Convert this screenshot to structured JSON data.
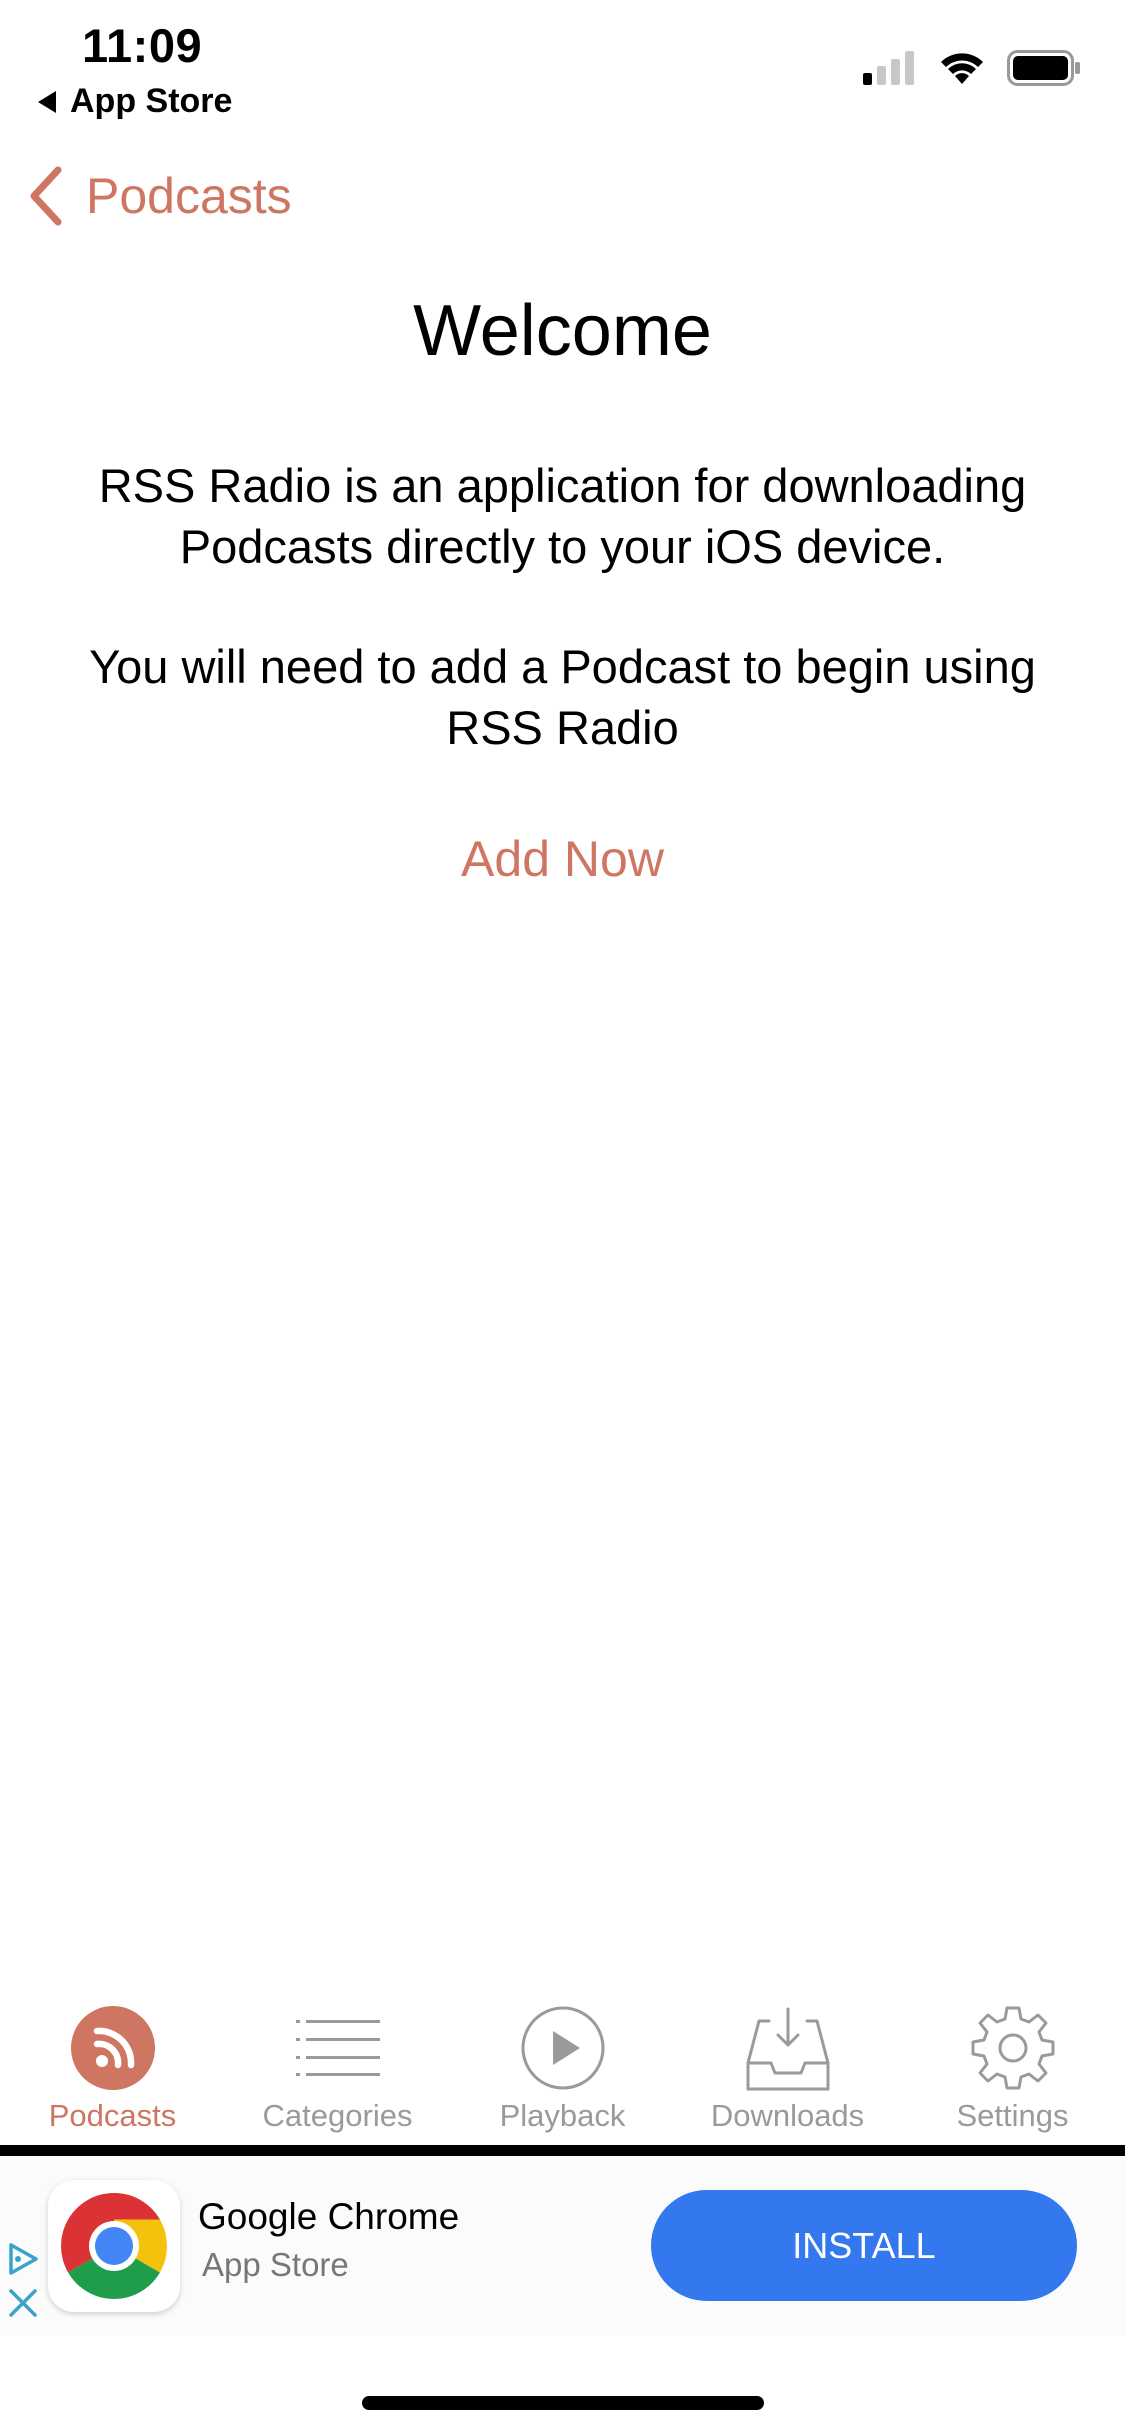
{
  "status_bar": {
    "time": "11:09",
    "back_app": "App Store",
    "icons": [
      "cellular-signal-icon",
      "wifi-icon",
      "battery-icon"
    ]
  },
  "nav": {
    "back_label": "Podcasts"
  },
  "welcome": {
    "title": "Welcome",
    "description": "RSS Radio is an application for downloading Podcasts directly to your iOS device.",
    "instruction": "You will need to add a Podcast to begin using RSS Radio",
    "action_label": "Add Now"
  },
  "tabs": [
    {
      "label": "Podcasts",
      "icon": "rss-icon",
      "active": true
    },
    {
      "label": "Categories",
      "icon": "list-icon",
      "active": false
    },
    {
      "label": "Playback",
      "icon": "play-icon",
      "active": false
    },
    {
      "label": "Downloads",
      "icon": "download-tray-icon",
      "active": false
    },
    {
      "label": "Settings",
      "icon": "gear-icon",
      "active": false
    }
  ],
  "ad": {
    "app_name": "Google Chrome",
    "store": "App Store",
    "install_label": "INSTALL"
  },
  "colors": {
    "accent": "#cf7663",
    "install_button": "#3478f0",
    "inactive_tab": "#9a9a9a"
  }
}
